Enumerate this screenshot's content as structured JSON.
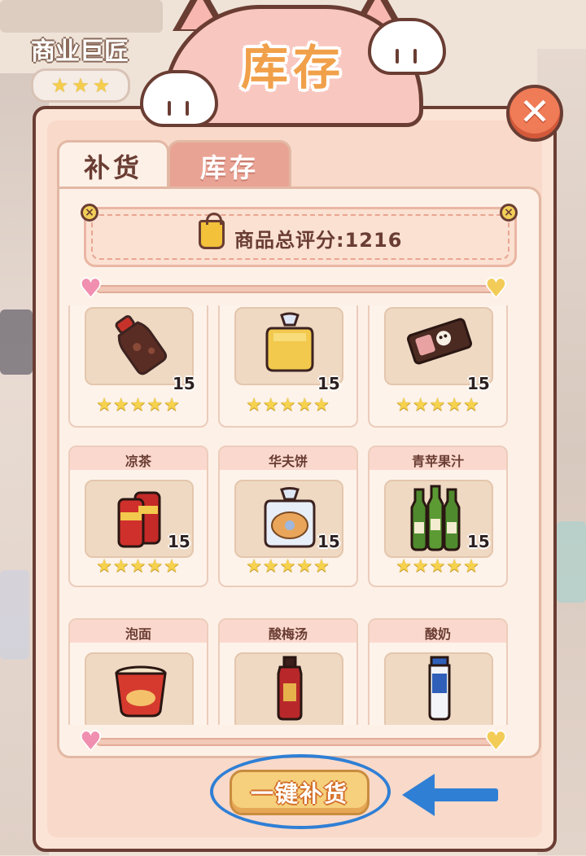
{
  "header": {
    "title": "库存"
  },
  "player_badge": {
    "title": "商业巨匠",
    "stars": [
      "★",
      "★",
      "★"
    ]
  },
  "tabs": {
    "restock": "补货",
    "inventory": "库存"
  },
  "close_icon": "✕",
  "score": {
    "label": "商品总评分:1216"
  },
  "rail_icons": {
    "heart": "♥",
    "end": "♥"
  },
  "products": [
    {
      "name": "",
      "qty": "15",
      "stars": "★★★★★",
      "icon": "soda-bottle-icon"
    },
    {
      "name": "",
      "qty": "15",
      "stars": "★★★★★",
      "icon": "bread-bag-icon"
    },
    {
      "name": "",
      "qty": "15",
      "stars": "★★★★★",
      "icon": "snack-bar-icon"
    },
    {
      "name": "凉茶",
      "qty": "15",
      "stars": "★★★★★",
      "icon": "herbal-tea-cans-icon"
    },
    {
      "name": "华夫饼",
      "qty": "15",
      "stars": "★★★★★",
      "icon": "waffle-bag-icon"
    },
    {
      "name": "青苹果汁",
      "qty": "15",
      "stars": "★★★★★",
      "icon": "apple-juice-bottles-icon"
    },
    {
      "name": "泡面",
      "qty": "",
      "stars": "",
      "icon": "instant-noodles-icon"
    },
    {
      "name": "酸梅汤",
      "qty": "",
      "stars": "",
      "icon": "plum-drink-bottle-icon"
    },
    {
      "name": "酸奶",
      "qty": "",
      "stars": "",
      "icon": "yogurt-bottle-icon"
    }
  ],
  "action": {
    "restock_all": "一键补货"
  },
  "colors": {
    "accent": "#f1a04a",
    "outline": "#6a3d33",
    "highlight": "#2f7fd5",
    "panel": "#fdf0e7"
  }
}
